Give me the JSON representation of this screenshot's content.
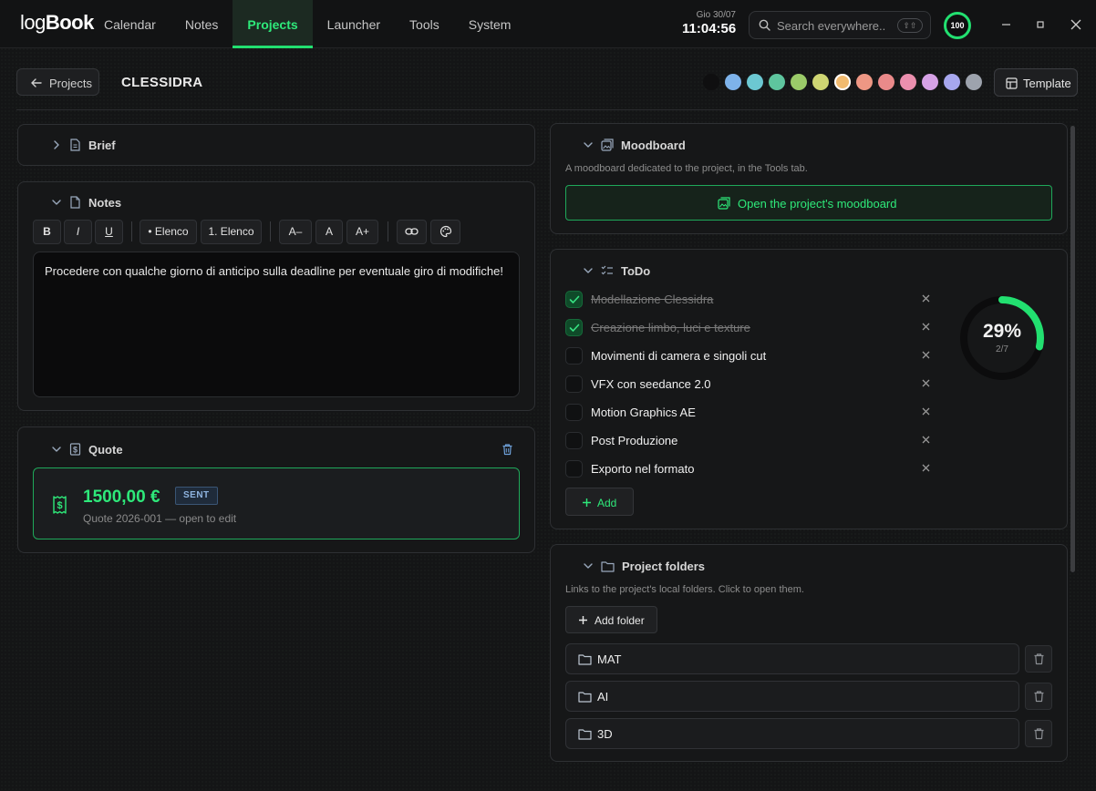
{
  "app": {
    "logo_part1": "log",
    "logo_part2": "Book"
  },
  "nav": {
    "items": [
      {
        "label": "Calendar"
      },
      {
        "label": "Notes"
      },
      {
        "label": "Projects",
        "active": true
      },
      {
        "label": "Launcher"
      },
      {
        "label": "Tools"
      },
      {
        "label": "System"
      }
    ]
  },
  "clock": {
    "date": "Gio 30/07",
    "time": "11:04:56"
  },
  "search": {
    "placeholder": "Search everywhere...",
    "shortcut": "⇧⇧"
  },
  "score": "100",
  "header": {
    "back_label": "Projects",
    "project_title": "CLESSIDRA",
    "template_label": "Template",
    "swatches": [
      "#0f0f10",
      "#7eb3ea",
      "#6cc8d2",
      "#5ec59e",
      "#9bcb69",
      "#cfd673",
      "#f2bb6f",
      "#ee9784",
      "#ea8a8a",
      "#eb8fae",
      "#d6a2e6",
      "#a7a7ee",
      "#9da3ad"
    ],
    "selected_swatch": 6
  },
  "brief": {
    "title": "Brief"
  },
  "notes": {
    "title": "Notes",
    "toolbar": {
      "bold": "B",
      "italic": "I",
      "underline": "U",
      "bullet": "• Elenco",
      "numbered": "1. Elenco",
      "font_smaller": "A–",
      "font_reset": "A",
      "font_larger": "A+"
    },
    "content": "Procedere con qualche giorno di anticipo sulla deadline per eventuale giro di modifiche!"
  },
  "quote": {
    "title": "Quote",
    "amount": "1500,00 €",
    "status": "SENT",
    "subtitle": "Quote 2026-001 — open to edit"
  },
  "moodboard": {
    "title": "Moodboard",
    "description": "A moodboard dedicated to the project, in the Tools tab.",
    "button_label": "Open the project's moodboard"
  },
  "todo": {
    "title": "ToDo",
    "items": [
      {
        "text": "Modellazione Clessidra",
        "done": true
      },
      {
        "text": "Creazione limbo, luci e texture",
        "done": true
      },
      {
        "text": "Movimenti di camera e singoli cut",
        "done": false
      },
      {
        "text": "VFX con seedance 2.0",
        "done": false
      },
      {
        "text": "Motion Graphics AE",
        "done": false
      },
      {
        "text": "Post Produzione",
        "done": false
      },
      {
        "text": "Exporto nel formato",
        "done": false
      }
    ],
    "add_label": "Add",
    "progress_percent": "29%",
    "progress_count": "2/7",
    "progress_fraction": 0.2857
  },
  "folders": {
    "title": "Project folders",
    "description": "Links to the project's local folders. Click to open them.",
    "add_label": "Add folder",
    "items": [
      {
        "name": "MAT"
      },
      {
        "name": "AI"
      },
      {
        "name": "3D"
      }
    ]
  },
  "colors": {
    "accent": "#22e070",
    "background": "#141516",
    "panel": "#161718"
  }
}
